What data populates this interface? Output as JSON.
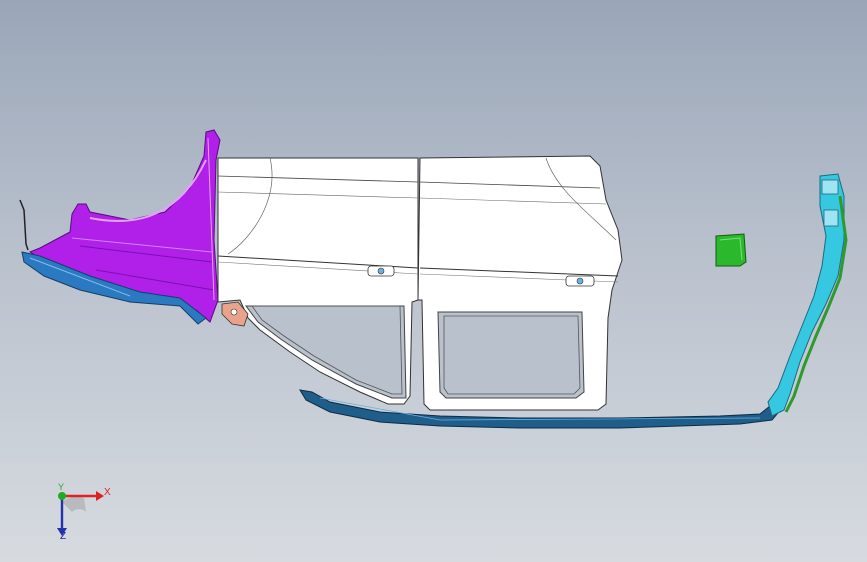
{
  "viewport": {
    "background_top": "#9aa6b8",
    "background_bottom": "#d7dbe0"
  },
  "parts": {
    "fender_color": "#b020e8",
    "door_panel_color": "#ffffff",
    "rocker_sill_color": "#1f5e8a",
    "front_trim_color": "#2b79c0",
    "rear_pillar_color": "#35c8e0",
    "rear_pillar_edge_color": "#2e9a2e",
    "fuel_flap_color": "#2cb82c",
    "bracket_color": "#e9a38a"
  },
  "triad": {
    "x_label": "X",
    "y_label": "Z",
    "z_label": "Y",
    "x_color": "#dd2222",
    "y_color": "#2233aa",
    "z_color": "#22aa22"
  }
}
